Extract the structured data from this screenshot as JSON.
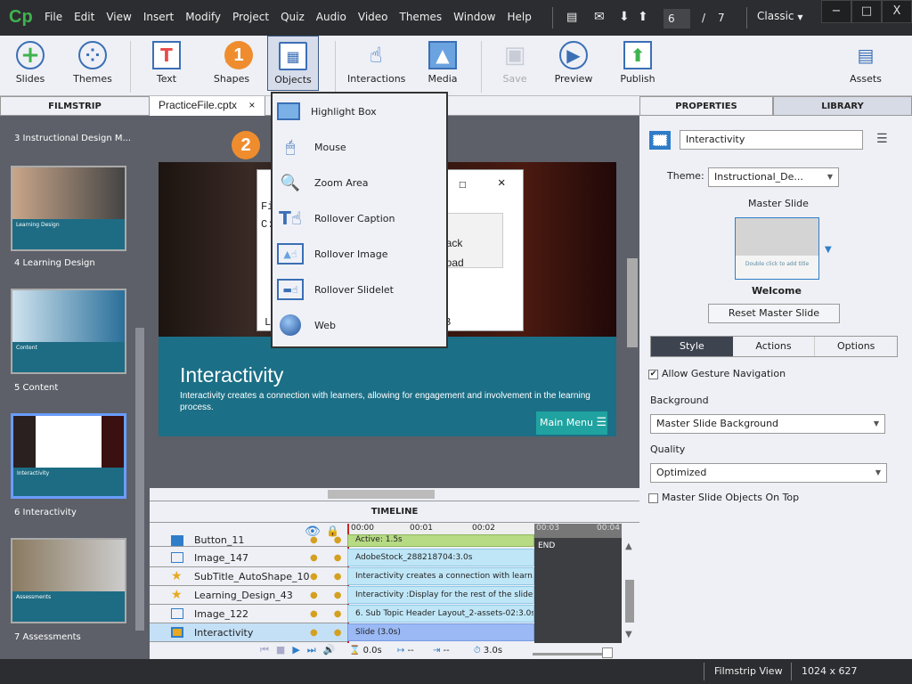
{
  "app": {
    "logo": "Cp",
    "menu": [
      "File",
      "Edit",
      "View",
      "Insert",
      "Modify",
      "Project",
      "Quiz",
      "Audio",
      "Video",
      "Themes",
      "Window",
      "Help"
    ],
    "current_slide": "6",
    "slide_sep": "/",
    "total_slides": "7",
    "workspace": "Classic",
    "min": "−",
    "max": "□",
    "close": "X"
  },
  "toolbar": {
    "slides": "Slides",
    "themes": "Themes",
    "text": "Text",
    "shapes": "Shapes",
    "objects": "Objects",
    "interactions": "Interactions",
    "media": "Media",
    "save": "Save",
    "preview": "Preview",
    "publish": "Publish",
    "assets": "Assets"
  },
  "callouts": {
    "one": "1",
    "two": "2"
  },
  "panels": {
    "filmstrip": "FILMSTRIP",
    "doc_tab": "PracticeFile.cptx",
    "doc_close": "×",
    "properties": "PROPERTIES",
    "library": "LIBRARY",
    "timeline": "TIMELINE"
  },
  "filmstrip": [
    {
      "label": "3 Instructional Design M..."
    },
    {
      "label": "4 Learning Design",
      "thumb_title": "Learning Design"
    },
    {
      "label": "5 Content",
      "thumb_title": "Content"
    },
    {
      "label": "6 Interactivity",
      "thumb_title": "Interactivity",
      "selected": true
    },
    {
      "label": "7 Assessments",
      "thumb_title": "Assessments"
    }
  ],
  "objects_menu": [
    "Highlight Box",
    "Mouse",
    "Zoom Area",
    "Rollover Caption",
    "Rollover Image",
    "Rollover Slidelet",
    "Web"
  ],
  "slide": {
    "title": "Interactivity",
    "body": "Interactivity creates a connection with learners, allowing for engagement and involvement in the learning process.",
    "main_menu": "Main Menu",
    "notepad": {
      "f1": "Fi",
      "f2": "C:",
      "f3": "back",
      "f4": "epad",
      "f5": "L",
      "f6": "B"
    }
  },
  "timeline": {
    "ruler": [
      "00:00",
      "00:01",
      "00:02",
      "00:03",
      "00:04"
    ],
    "rows": [
      {
        "name": "Button_11",
        "icon": "button-icon",
        "bar": "Active: 1.5s"
      },
      {
        "name": "Image_147",
        "icon": "image-icon",
        "bar": "AdobeStock_288218704:3.0s"
      },
      {
        "name": "SubTitle_AutoShape_10",
        "icon": "star-icon",
        "bar": "Interactivity creates a connection with learn..."
      },
      {
        "name": "Learning_Design_43",
        "icon": "star-icon",
        "bar": "Interactivity :Display for the rest of the slide"
      },
      {
        "name": "Image_122",
        "icon": "image-icon",
        "bar": "6. Sub Topic Header Layout_2-assets-02:3.0s"
      },
      {
        "name": "Interactivity",
        "icon": "slide-icon",
        "bar": "Slide (3.0s)"
      }
    ],
    "end": "END",
    "start_time": "0.0s",
    "in": "--",
    "out": "--",
    "duration": "3.0s"
  },
  "properties": {
    "name": "Interactivity",
    "theme_label": "Theme:",
    "theme": "Instructional_De...",
    "master_slide": "Master Slide",
    "master_thumb": "Double click to add title",
    "master_name": "Welcome",
    "reset": "Reset Master Slide",
    "tabs": [
      "Style",
      "Actions",
      "Options"
    ],
    "gesture": "Allow Gesture Navigation",
    "gesture_checked": true,
    "background_label": "Background",
    "background": "Master Slide Background",
    "quality_label": "Quality",
    "quality": "Optimized",
    "objects_on_top": "Master Slide Objects On Top",
    "objects_on_top_checked": false
  },
  "status": {
    "view": "Filmstrip View",
    "size": "1024 x 627"
  },
  "colors": {
    "accent": "#2f7dc9",
    "callout": "#ef8d2e",
    "teal": "#1b6f86",
    "button_teal": "#20a3a0"
  }
}
